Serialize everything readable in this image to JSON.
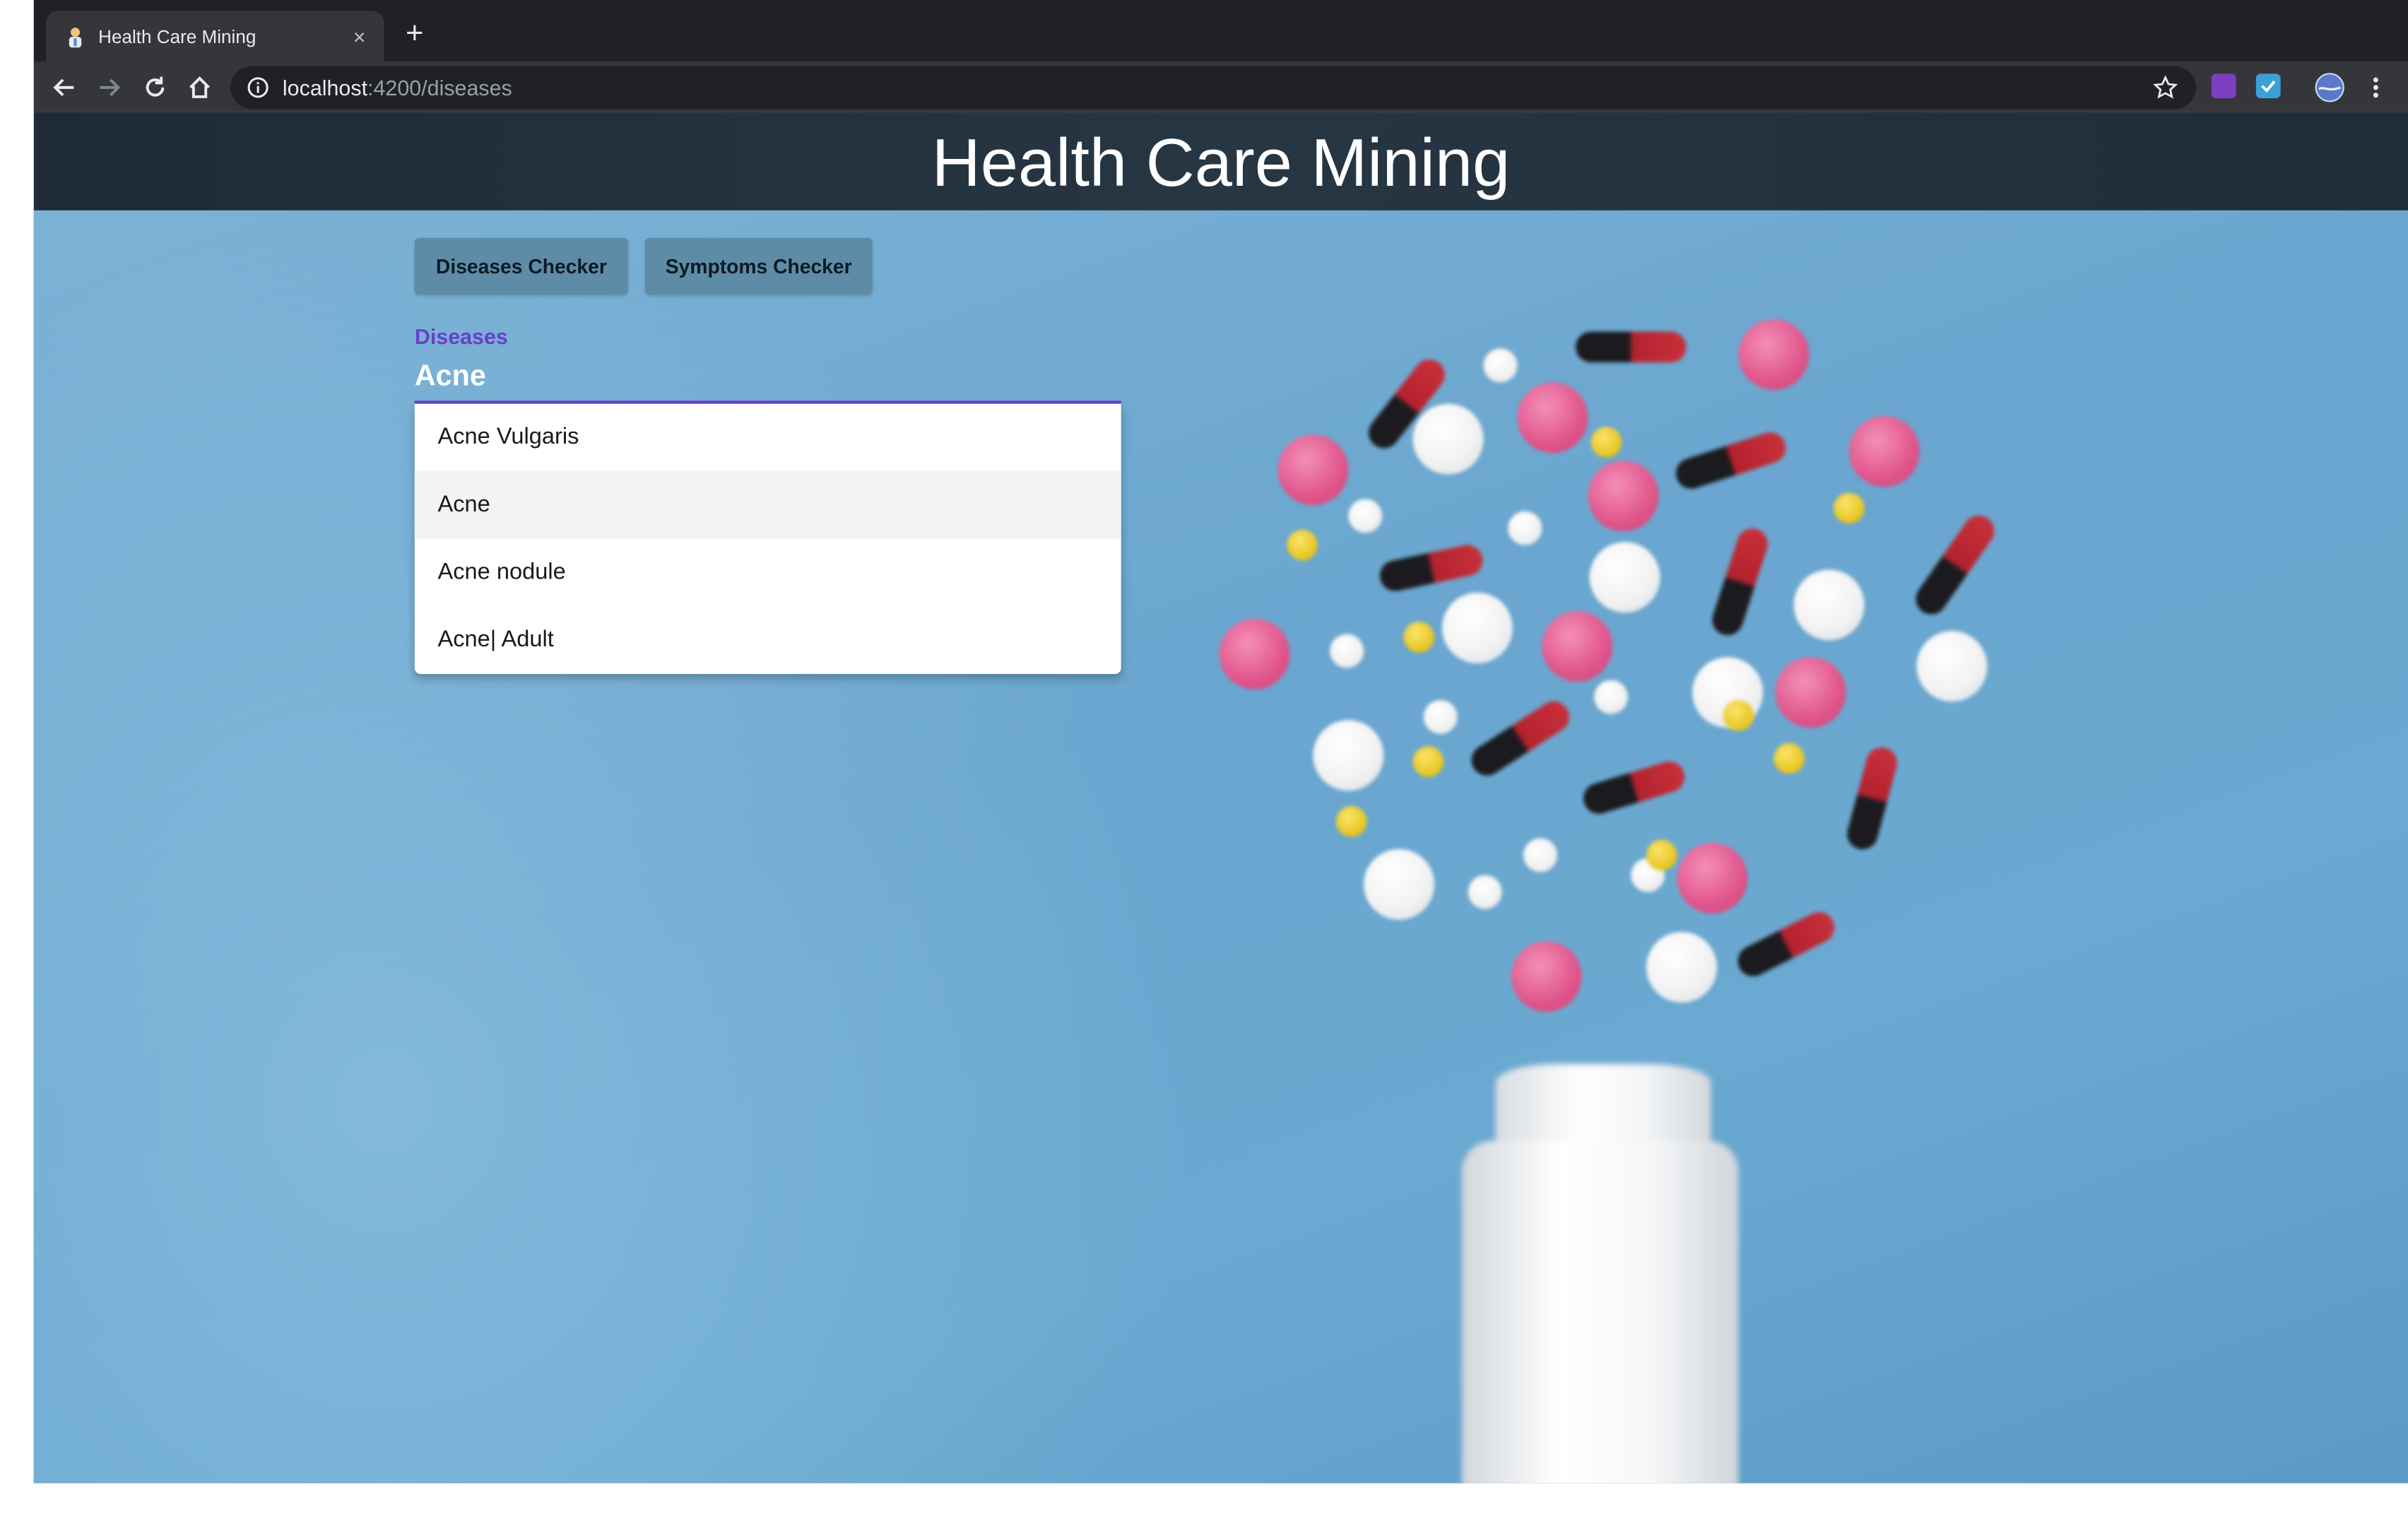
{
  "browser": {
    "tab": {
      "title": "Health Care Mining",
      "favicon": "doctor-icon",
      "close": "×"
    },
    "new_tab": "+",
    "address_bar": {
      "host": "localhost",
      "path": ":4200/diseases"
    },
    "toolbar_icons": [
      "back-icon",
      "forward-icon",
      "reload-icon",
      "home-icon",
      "site-info-icon",
      "bookmark-star-icon",
      "onenote-extension-icon",
      "todo-extension-icon",
      "profile-avatar-icon",
      "menu-icon"
    ]
  },
  "app": {
    "title": "Health Care Mining",
    "nav": {
      "diseases_button": "Diseases Checker",
      "symptoms_button": "Symptoms Checker"
    },
    "form": {
      "label": "Diseases",
      "value": "Acne"
    },
    "autocomplete": {
      "options": [
        "Acne Vulgaris",
        "Acne",
        "Acne nodule",
        "Acne| Adult"
      ],
      "highlighted_index": 1
    }
  },
  "colors": {
    "header_bg": "#263642",
    "page_bg": "#6aa6cf",
    "button_bg": "#5e8ca7",
    "accent": "#6a3fc8"
  }
}
